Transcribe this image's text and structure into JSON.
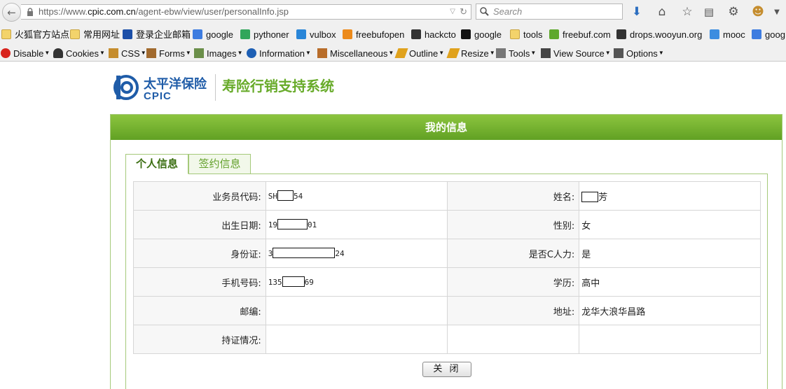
{
  "browser": {
    "url_prefix": "https://www.",
    "url_host": "cpic.com.cn",
    "url_path": "/agent-ebw/view/user/personalInfo.jsp",
    "search_placeholder": "Search"
  },
  "bookmarks": [
    {
      "label": "火狐官方站点",
      "icon": "folder-icon"
    },
    {
      "label": "常用网址",
      "icon": "folder-icon"
    },
    {
      "label": "登录企业邮箱",
      "icon": "mail-icon"
    },
    {
      "label": "google",
      "icon": "google-icon"
    },
    {
      "label": "pythoner",
      "icon": "python-icon"
    },
    {
      "label": "vulbox",
      "icon": "hexagon-icon"
    },
    {
      "label": "freebufopen",
      "icon": "freebuf-icon"
    },
    {
      "label": "hackcto",
      "icon": "hackcto-icon"
    },
    {
      "label": "google",
      "icon": "github-icon"
    },
    {
      "label": "tools",
      "icon": "folder-icon"
    },
    {
      "label": "freebuf.com",
      "icon": "freebuf-icon"
    },
    {
      "label": "drops.wooyun.org",
      "icon": "drops-icon"
    },
    {
      "label": "mooc",
      "icon": "mooc-icon"
    },
    {
      "label": "goog",
      "icon": "google-icon"
    }
  ],
  "devtools": [
    {
      "label": "Disable",
      "icon": "disable-icon"
    },
    {
      "label": "Cookies",
      "icon": "cookie-icon"
    },
    {
      "label": "CSS",
      "icon": "css-icon"
    },
    {
      "label": "Forms",
      "icon": "forms-icon"
    },
    {
      "label": "Images",
      "icon": "images-icon"
    },
    {
      "label": "Information",
      "icon": "info-icon"
    },
    {
      "label": "Miscellaneous",
      "icon": "misc-icon"
    },
    {
      "label": "Outline",
      "icon": "pencil-icon"
    },
    {
      "label": "Resize",
      "icon": "pencil-icon"
    },
    {
      "label": "Tools",
      "icon": "wrench-icon"
    },
    {
      "label": "View Source",
      "icon": "view-source-icon"
    },
    {
      "label": "Options",
      "icon": "options-icon"
    }
  ],
  "logo": {
    "company_cn": "太平洋保险",
    "company_en": "CPIC",
    "system_name": "寿险行销支持系统"
  },
  "panel": {
    "title": "我的信息",
    "tabs": [
      "个人信息",
      "签约信息"
    ]
  },
  "info": {
    "agent_code_label": "业务员代码:",
    "agent_code_prefix": "SH",
    "agent_code_suffix": "54",
    "name_label": "姓名:",
    "name_suffix": "芳",
    "birth_label": "出生日期:",
    "birth_prefix": "19",
    "birth_suffix": "01",
    "gender_label": "性别:",
    "gender_value": "女",
    "id_label": "身份证:",
    "id_prefix": "3",
    "id_suffix": "24",
    "c_staff_label": "是否C人力:",
    "c_staff_value": "是",
    "phone_label": "手机号码:",
    "phone_prefix": "135",
    "phone_suffix": "69",
    "education_label": "学历:",
    "education_value": "高中",
    "postcode_label": "邮编:",
    "postcode_value": "",
    "address_label": "地址:",
    "address_value": "龙华大浪华昌路",
    "certificate_label": "持证情况:",
    "certificate_value": ""
  },
  "close_button": "关 闭"
}
